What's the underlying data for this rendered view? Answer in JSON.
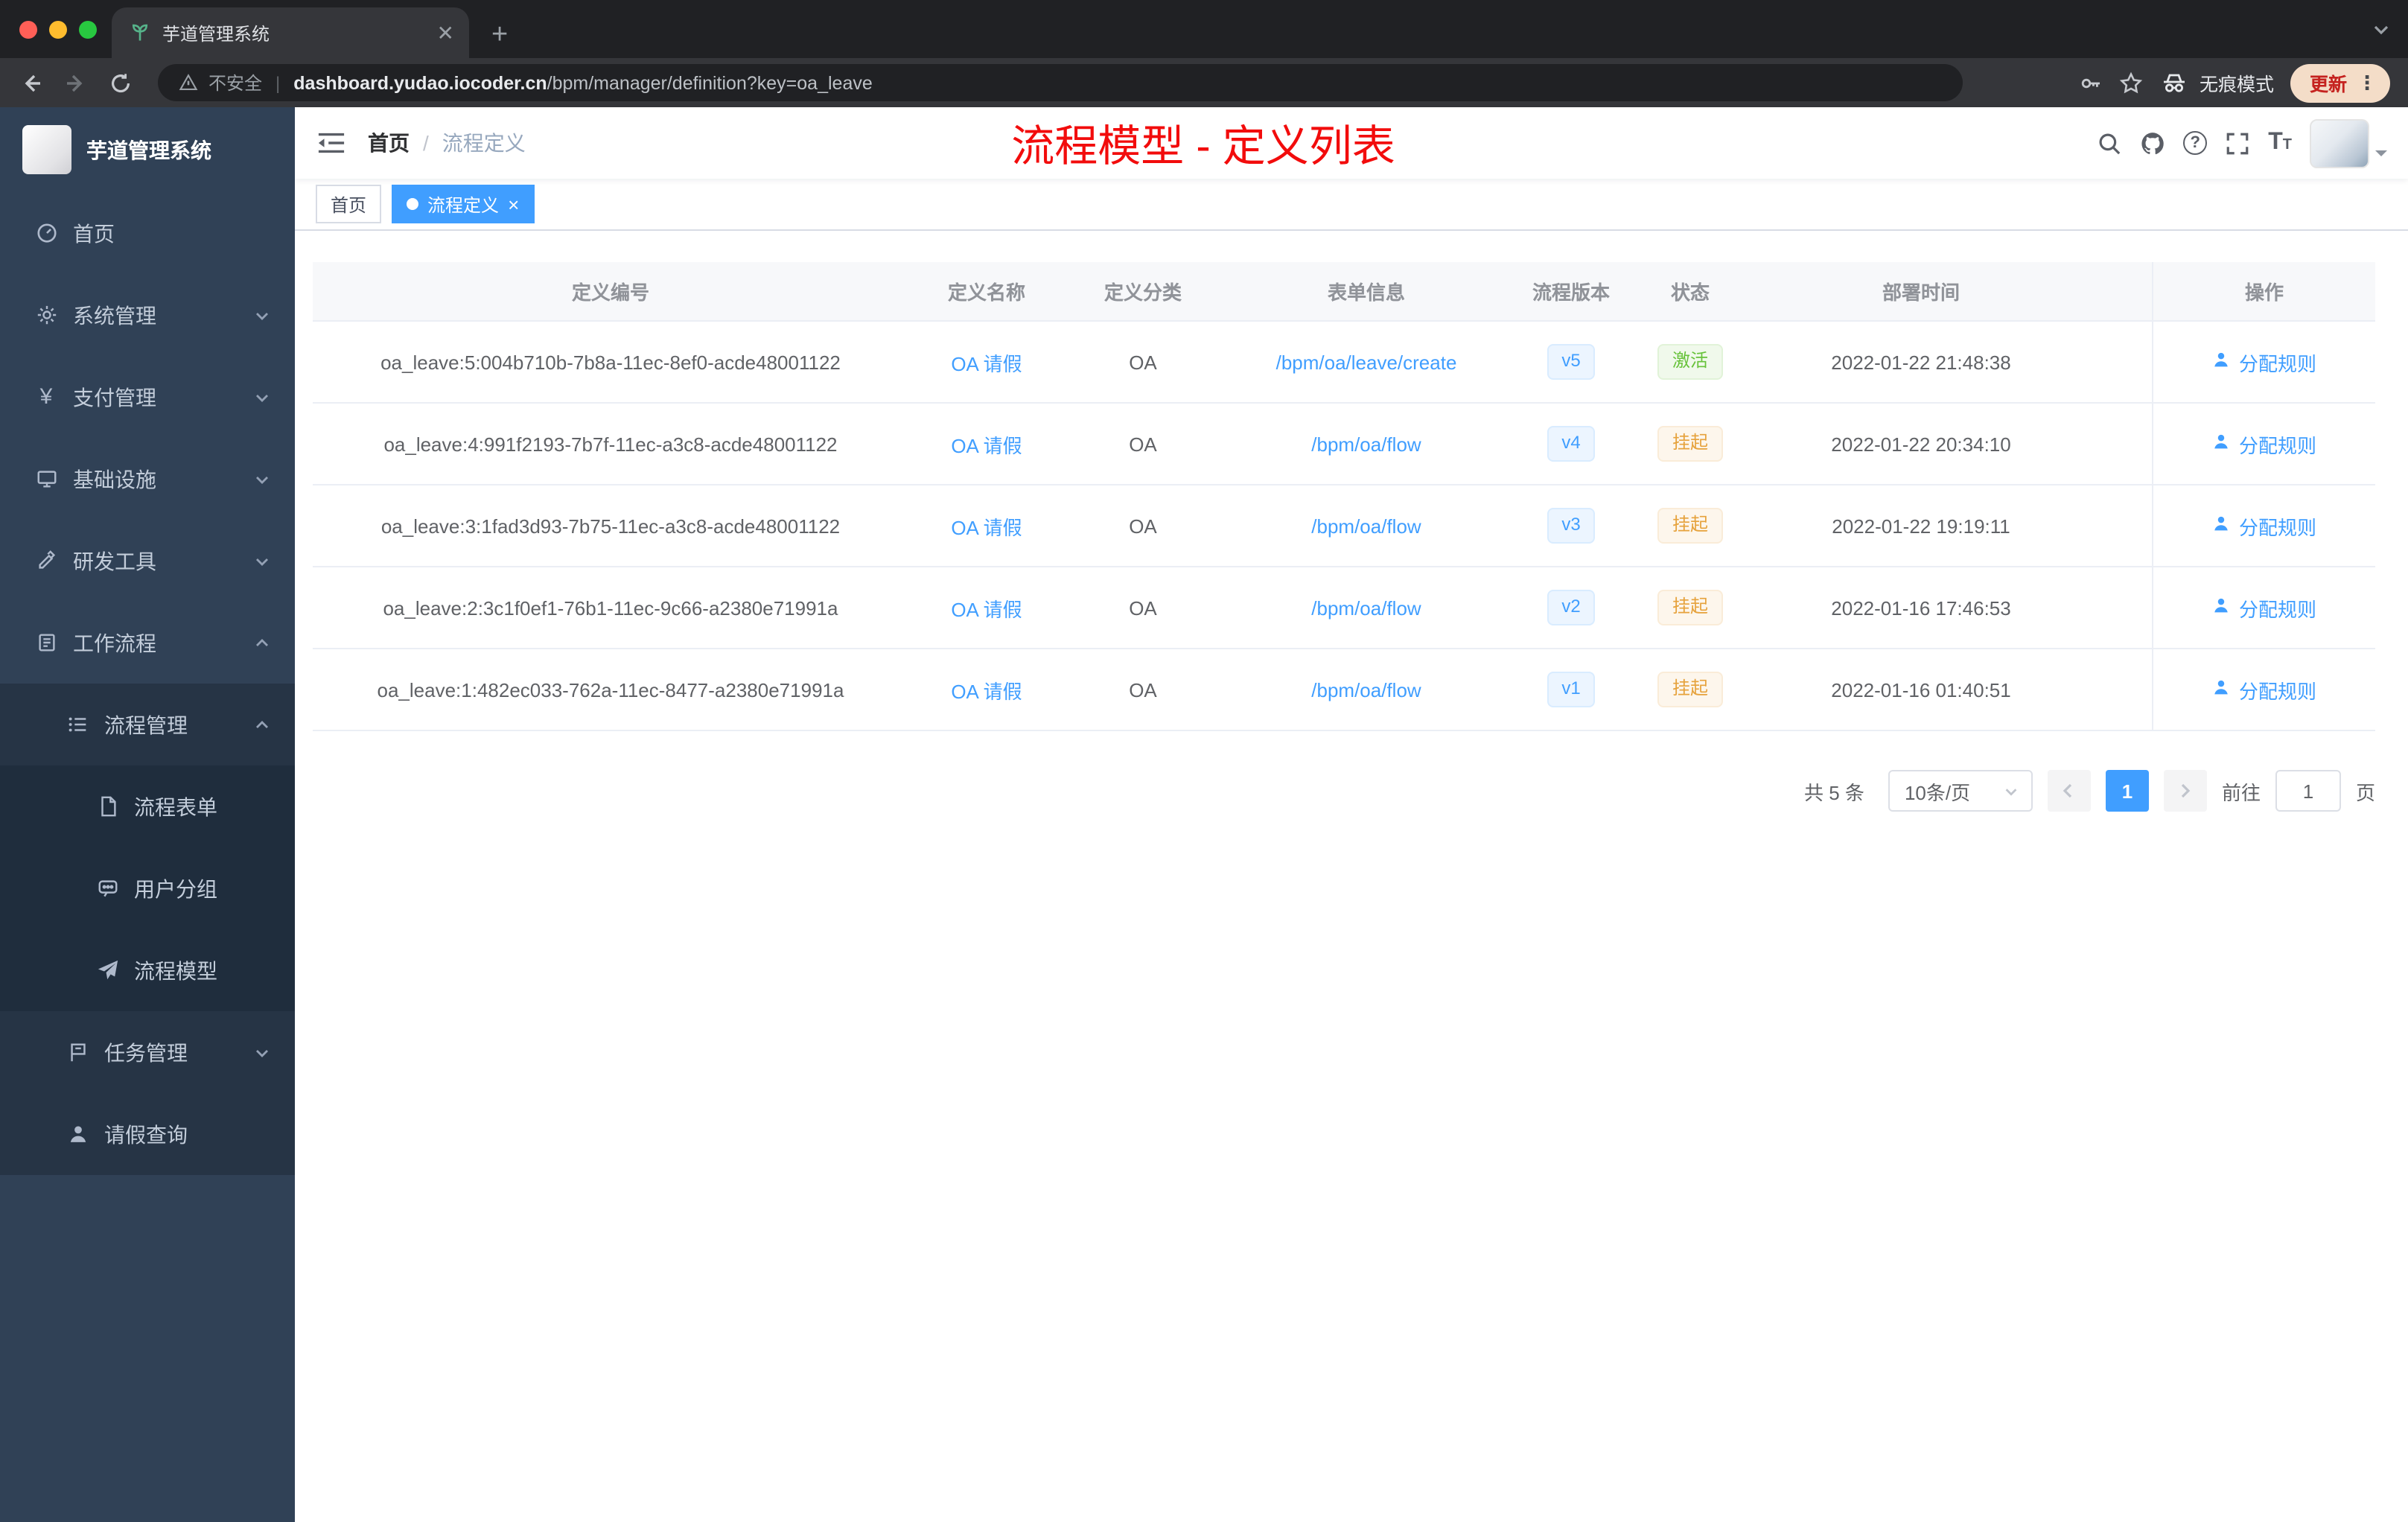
{
  "colors": {
    "accent_blue": "#409eff",
    "title_red": "#f20c0c",
    "sidebar_bg": "#304156"
  },
  "browser": {
    "tab_title": "芋道管理系统",
    "security_label": "不安全",
    "url_host": "dashboard.yudao.iocoder.cn",
    "url_path": "/bpm/manager/definition?key=oa_leave",
    "incognito_label": "无痕模式",
    "update_label": "更新"
  },
  "sidebar": {
    "logo_title": "芋道管理系统",
    "items": [
      {
        "label": "首页",
        "icon": "dashboard-icon",
        "level": 1
      },
      {
        "label": "系统管理",
        "icon": "gear-icon",
        "level": 1,
        "chevron": "down"
      },
      {
        "label": "支付管理",
        "icon": "yen-icon",
        "level": 1,
        "chevron": "down"
      },
      {
        "label": "基础设施",
        "icon": "monitor-icon",
        "level": 1,
        "chevron": "down"
      },
      {
        "label": "研发工具",
        "icon": "tools-icon",
        "level": 1,
        "chevron": "down"
      },
      {
        "label": "工作流程",
        "icon": "workflow-icon",
        "level": 1,
        "chevron": "up"
      },
      {
        "label": "流程管理",
        "icon": "list-icon",
        "level": 2,
        "chevron": "up"
      },
      {
        "label": "流程表单",
        "icon": "form-icon",
        "level": 3
      },
      {
        "label": "用户分组",
        "icon": "group-icon",
        "level": 3
      },
      {
        "label": "流程模型",
        "icon": "send-icon",
        "level": 3
      },
      {
        "label": "任务管理",
        "icon": "task-icon",
        "level": 2,
        "chevron": "down"
      },
      {
        "label": "请假查询",
        "icon": "person-icon",
        "level": 2
      }
    ]
  },
  "header": {
    "breadcrumb": [
      "首页",
      "流程定义"
    ],
    "breadcrumb_sep": "/",
    "page_title": "流程模型 - 定义列表"
  },
  "tags": [
    {
      "label": "首页",
      "active": false
    },
    {
      "label": "流程定义",
      "active": true,
      "closable": true
    }
  ],
  "table": {
    "columns": [
      "定义编号",
      "定义名称",
      "定义分类",
      "表单信息",
      "流程版本",
      "状态",
      "部署时间",
      "操作"
    ],
    "rows": [
      {
        "id": "oa_leave:5:004b710b-7b8a-11ec-8ef0-acde48001122",
        "name": "OA 请假",
        "category": "OA",
        "form": "/bpm/oa/leave/create",
        "version": "v5",
        "status": "激活",
        "status_type": "success",
        "deploy_time": "2022-01-22 21:48:38",
        "action": "分配规则"
      },
      {
        "id": "oa_leave:4:991f2193-7b7f-11ec-a3c8-acde48001122",
        "name": "OA 请假",
        "category": "OA",
        "form": "/bpm/oa/flow",
        "version": "v4",
        "status": "挂起",
        "status_type": "warning",
        "deploy_time": "2022-01-22 20:34:10",
        "action": "分配规则"
      },
      {
        "id": "oa_leave:3:1fad3d93-7b75-11ec-a3c8-acde48001122",
        "name": "OA 请假",
        "category": "OA",
        "form": "/bpm/oa/flow",
        "version": "v3",
        "status": "挂起",
        "status_type": "warning",
        "deploy_time": "2022-01-22 19:19:11",
        "action": "分配规则"
      },
      {
        "id": "oa_leave:2:3c1f0ef1-76b1-11ec-9c66-a2380e71991a",
        "name": "OA 请假",
        "category": "OA",
        "form": "/bpm/oa/flow",
        "version": "v2",
        "status": "挂起",
        "status_type": "warning",
        "deploy_time": "2022-01-16 17:46:53",
        "action": "分配规则"
      },
      {
        "id": "oa_leave:1:482ec033-762a-11ec-8477-a2380e71991a",
        "name": "OA 请假",
        "category": "OA",
        "form": "/bpm/oa/flow",
        "version": "v1",
        "status": "挂起",
        "status_type": "warning",
        "deploy_time": "2022-01-16 01:40:51",
        "action": "分配规则"
      }
    ]
  },
  "pagination": {
    "total_label": "共 5 条",
    "page_size_label": "10条/页",
    "current_page": "1",
    "goto_label": "前往",
    "goto_value": "1",
    "page_suffix": "页"
  }
}
